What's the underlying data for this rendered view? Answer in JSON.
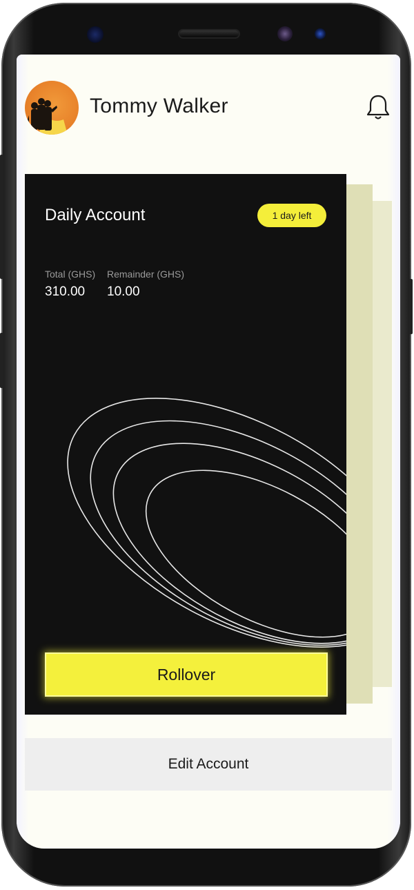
{
  "user": {
    "name": "Tommy Walker"
  },
  "header": {
    "notification_icon": "bell-icon"
  },
  "account_card": {
    "title": "Daily Account",
    "badge": "1 day left",
    "stats": [
      {
        "label": "Total (GHS)",
        "value": "310.00"
      },
      {
        "label": "Remainder (GHS)",
        "value": "10.00"
      }
    ],
    "rollover_label": "Rollover"
  },
  "actions": {
    "edit_label": "Edit Account"
  },
  "colors": {
    "accent": "#f4f03c",
    "card_bg": "#111111",
    "screen_bg": "#fdfdf5",
    "avatar_bg": "#e8822a",
    "stack_card": "#dfdfb6"
  }
}
